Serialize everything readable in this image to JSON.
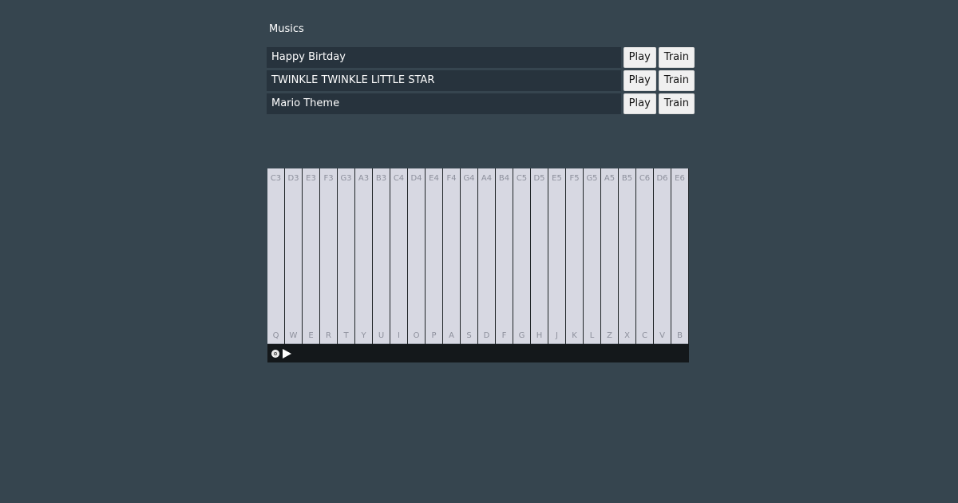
{
  "musics": {
    "title": "Musics",
    "songs": [
      {
        "name": "Happy Birtday",
        "play_label": "Play",
        "train_label": "Train"
      },
      {
        "name": "TWINKLE TWINKLE LITTLE STAR",
        "play_label": "Play",
        "train_label": "Train"
      },
      {
        "name": "Mario Theme",
        "play_label": "Play",
        "train_label": "Train"
      }
    ]
  },
  "piano": {
    "keys": [
      {
        "note": "C3",
        "key": "Q"
      },
      {
        "note": "D3",
        "key": "W"
      },
      {
        "note": "E3",
        "key": "E"
      },
      {
        "note": "F3",
        "key": "R"
      },
      {
        "note": "G3",
        "key": "T"
      },
      {
        "note": "A3",
        "key": "Y"
      },
      {
        "note": "B3",
        "key": "U"
      },
      {
        "note": "C4",
        "key": "I"
      },
      {
        "note": "D4",
        "key": "O"
      },
      {
        "note": "E4",
        "key": "P"
      },
      {
        "note": "F4",
        "key": "A"
      },
      {
        "note": "G4",
        "key": "S"
      },
      {
        "note": "A4",
        "key": "D"
      },
      {
        "note": "B4",
        "key": "F"
      },
      {
        "note": "C5",
        "key": "G"
      },
      {
        "note": "D5",
        "key": "H"
      },
      {
        "note": "E5",
        "key": "J"
      },
      {
        "note": "F5",
        "key": "K"
      },
      {
        "note": "G5",
        "key": "L"
      },
      {
        "note": "A5",
        "key": "Z"
      },
      {
        "note": "B5",
        "key": "X"
      },
      {
        "note": "C6",
        "key": "C"
      },
      {
        "note": "D6",
        "key": "V"
      },
      {
        "note": "E6",
        "key": "B"
      }
    ],
    "controls": {
      "record_icon": "record-icon",
      "play_icon": "play-icon"
    }
  }
}
